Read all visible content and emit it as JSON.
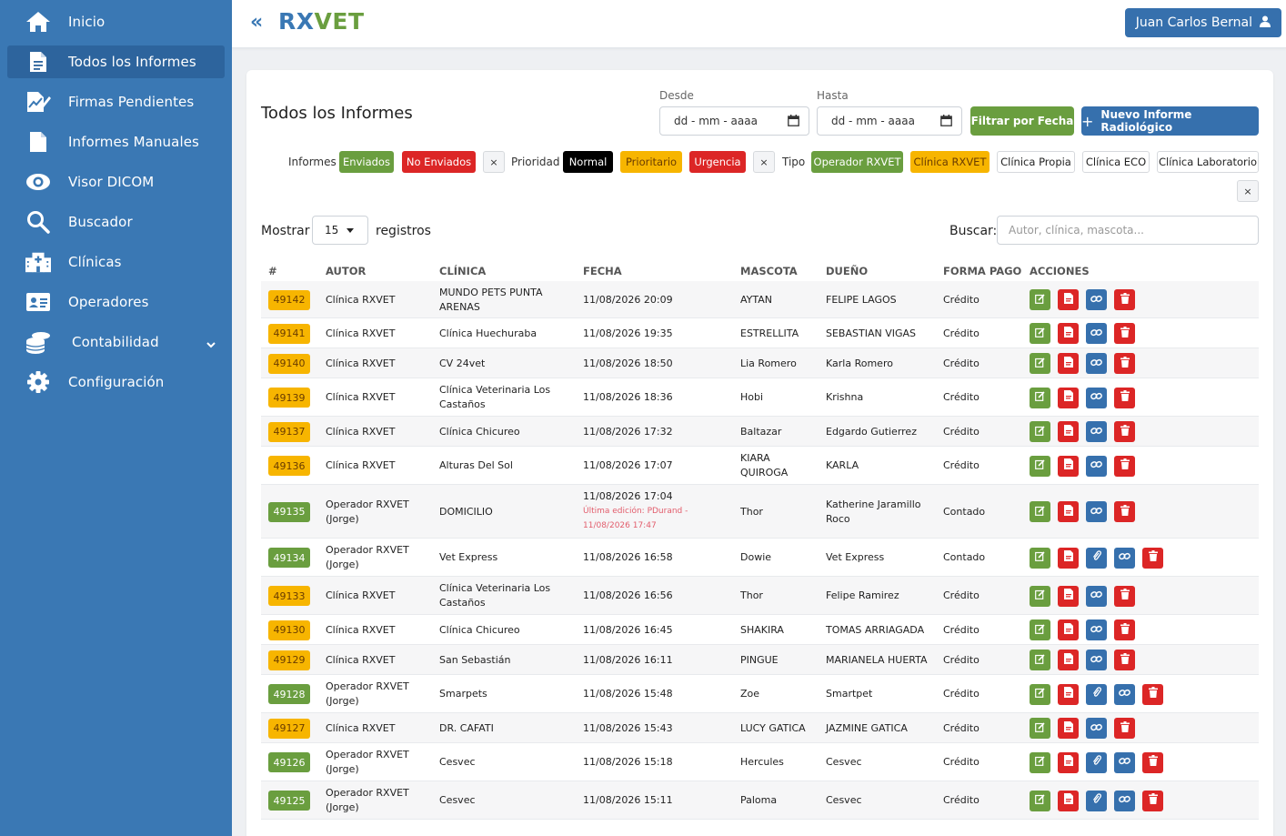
{
  "brand": {
    "rx": "RX",
    "vet": "VET"
  },
  "user": {
    "name": "Juan Carlos Bernal"
  },
  "sidebar": {
    "items": [
      {
        "label": "Inicio",
        "icon": "home-icon"
      },
      {
        "label": "Todos los Informes",
        "icon": "file-text-icon",
        "active": true
      },
      {
        "label": "Firmas Pendientes",
        "icon": "signature-icon"
      },
      {
        "label": "Informes Manuales",
        "icon": "file-icon"
      },
      {
        "label": "Visor DICOM",
        "icon": "eye-icon"
      },
      {
        "label": "Buscador",
        "icon": "search-icon"
      },
      {
        "label": "Clínicas",
        "icon": "hospital-icon"
      },
      {
        "label": "Operadores",
        "icon": "id-card-icon"
      },
      {
        "label": "Contabilidad",
        "icon": "coins-icon",
        "has_submenu": true
      },
      {
        "label": "Configuración",
        "icon": "gear-icon"
      }
    ]
  },
  "page": {
    "title": "Todos los Informes",
    "from_label": "Desde",
    "to_label": "Hasta",
    "date_placeholder": "dd - mm - aaaa",
    "filter_button": "Filtrar por Fecha",
    "new_button": "Nuevo Informe Radiológico"
  },
  "filters": {
    "informes_label": "Informes",
    "enviados": "Enviados",
    "no_enviados": "No Enviados",
    "prioridad_label": "Prioridad",
    "normal": "Normal",
    "prioritario": "Prioritario",
    "urgencia": "Urgencia",
    "tipo_label": "Tipo",
    "operador_rxvet": "Operador RXVET",
    "clinica_rxvet": "Clínica RXVET",
    "clinica_propia": "Clínica Propia",
    "clinica_eco": "Clínica ECO",
    "clinica_laboratorio": "Clínica Laboratorio",
    "clear": "×"
  },
  "table_controls": {
    "show_label": "Mostrar",
    "page_size": "15",
    "records_label": "registros",
    "search_label": "Buscar:",
    "search_placeholder": "Autor, clínica, mascota..."
  },
  "table": {
    "headers": [
      "#",
      "AUTOR",
      "CLÍNICA",
      "FECHA",
      "MASCOTA",
      "DUEÑO",
      "FORMA PAGO",
      "ACCIONES"
    ],
    "rows": [
      {
        "id": "49142",
        "badge": "yellow",
        "autor": "Clínica RXVET",
        "clinica": "MUNDO PETS PUNTA ARENAS",
        "fecha": "11/08/2026 20:09",
        "mascota": "AYTAN",
        "dueno": "FELIPE LAGOS",
        "pago": "Crédito",
        "actions": 4,
        "h": 41
      },
      {
        "id": "49141",
        "badge": "yellow",
        "autor": "Clínica RXVET",
        "clinica": "Clínica Huechuraba",
        "fecha": "11/08/2026 19:35",
        "mascota": "ESTRELLITA",
        "dueno": "SEBASTIAN VIGAS",
        "pago": "Crédito",
        "actions": 4,
        "h": 33
      },
      {
        "id": "49140",
        "badge": "yellow",
        "autor": "Clínica RXVET",
        "clinica": "CV 24vet",
        "fecha": "11/08/2026 18:50",
        "mascota": "Lia Romero",
        "dueno": "Karla Romero",
        "pago": "Crédito",
        "actions": 4,
        "h": 33
      },
      {
        "id": "49139",
        "badge": "yellow",
        "autor": "Clínica RXVET",
        "clinica": "Clínica Veterinaria Los Castaños",
        "fecha": "11/08/2026 18:36",
        "mascota": "Hobi",
        "dueno": "Krishna",
        "pago": "Crédito",
        "actions": 4,
        "h": 42
      },
      {
        "id": "49137",
        "badge": "yellow",
        "autor": "Clínica RXVET",
        "clinica": "Clínica Chicureo",
        "fecha": "11/08/2026 17:32",
        "mascota": "Baltazar",
        "dueno": "Edgardo Gutierrez",
        "pago": "Crédito",
        "actions": 4,
        "h": 33
      },
      {
        "id": "49136",
        "badge": "yellow",
        "autor": "Clínica RXVET",
        "clinica": "Alturas Del Sol",
        "fecha": "11/08/2026 17:07",
        "mascota": "KIARA QUIROGA",
        "dueno": "KARLA",
        "pago": "Crédito",
        "actions": 4,
        "h": 42
      },
      {
        "id": "49135",
        "badge": "green",
        "autor": "Operador RXVET (Jorge)",
        "clinica": "DOMICILIO",
        "fecha": "11/08/2026 17:04",
        "edit_note": "Última edición: PDurand - 11/08/2026 17:47",
        "mascota": "Thor",
        "dueno": "Katherine Jaramillo Roco",
        "pago": "Contado",
        "actions": 4,
        "h": 59
      },
      {
        "id": "49134",
        "badge": "green",
        "autor": "Operador RXVET (Jorge)",
        "clinica": "Vet Express",
        "fecha": "11/08/2026 16:58",
        "mascota": "Dowie",
        "dueno": "Vet Express",
        "pago": "Contado",
        "actions": 5,
        "h": 42
      },
      {
        "id": "49133",
        "badge": "yellow",
        "autor": "Clínica RXVET",
        "clinica": "Clínica Veterinaria Los Castaños",
        "fecha": "11/08/2026 16:56",
        "mascota": "Thor",
        "dueno": "Felipe Ramirez",
        "pago": "Crédito",
        "actions": 4,
        "h": 42
      },
      {
        "id": "49130",
        "badge": "yellow",
        "autor": "Clínica RXVET",
        "clinica": "Clínica Chicureo",
        "fecha": "11/08/2026 16:45",
        "mascota": "SHAKIRA",
        "dueno": "TOMAS ARRIAGADA",
        "pago": "Crédito",
        "actions": 4,
        "h": 33
      },
      {
        "id": "49129",
        "badge": "yellow",
        "autor": "Clínica RXVET",
        "clinica": "San Sebastián",
        "fecha": "11/08/2026 16:11",
        "mascota": "PINGUE",
        "dueno": "MARIANELA HUERTA",
        "pago": "Crédito",
        "actions": 4,
        "h": 33
      },
      {
        "id": "49128",
        "badge": "green",
        "autor": "Operador RXVET (Jorge)",
        "clinica": "Smarpets",
        "fecha": "11/08/2026 15:48",
        "mascota": "Zoe",
        "dueno": "Smartpet",
        "pago": "Crédito",
        "actions": 5,
        "h": 42
      },
      {
        "id": "49127",
        "badge": "yellow",
        "autor": "Clínica RXVET",
        "clinica": "DR. CAFATI",
        "fecha": "11/08/2026 15:43",
        "mascota": "LUCY GATICA",
        "dueno": "JAZMINE GATICA",
        "pago": "Crédito",
        "actions": 4,
        "h": 33
      },
      {
        "id": "49126",
        "badge": "green",
        "autor": "Operador RXVET (Jorge)",
        "clinica": "Cesvec",
        "fecha": "11/08/2026 15:18",
        "mascota": "Hercules",
        "dueno": "Cesvec",
        "pago": "Crédito",
        "actions": 5,
        "h": 42
      },
      {
        "id": "49125",
        "badge": "green",
        "autor": "Operador RXVET (Jorge)",
        "clinica": "Cesvec",
        "fecha": "11/08/2026 15:11",
        "mascota": "Paloma",
        "dueno": "Cesvec",
        "pago": "Crédito",
        "actions": 5,
        "h": 42
      }
    ]
  },
  "colors": {
    "primary": "#3670ad",
    "green": "#6a9e3f",
    "red": "#dc2626",
    "yellow": "#f7b500",
    "sidebar": "#3a78b4"
  }
}
